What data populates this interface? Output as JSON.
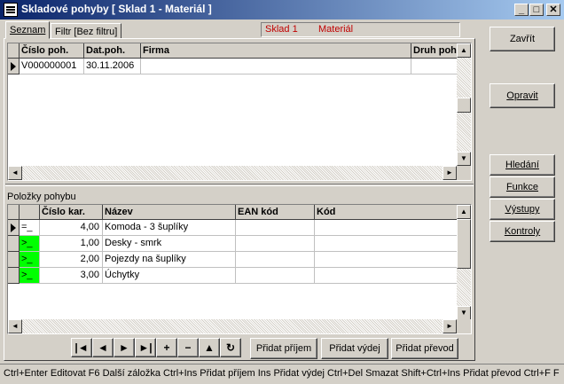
{
  "window": {
    "title": "Skladové pohyby [ Sklad 1 - Materiál ]",
    "minimize": "_",
    "restore": "□",
    "close": "✕"
  },
  "tabs": [
    {
      "label": "Seznam"
    },
    {
      "label": "Filtr [Bez filtru]"
    }
  ],
  "context": {
    "sklad": "Sklad 1",
    "material": "Materiál"
  },
  "top_grid": {
    "columns": [
      "Číslo poh.",
      "Dat.poh.",
      "Firma",
      "Druh pohy"
    ],
    "rows": [
      {
        "cislo": "V000000001",
        "datum": "30.11.2006",
        "firma": "",
        "druh": ""
      }
    ]
  },
  "items_section": {
    "label": "Položky pohybu"
  },
  "items_grid": {
    "columns": [
      "Číslo kar.",
      "Název",
      "EAN kód",
      "Kód"
    ],
    "rows": [
      {
        "status": "=_",
        "cislo": "4,00",
        "nazev": "Komoda - 3 šuplíky",
        "ean": "",
        "kod": ""
      },
      {
        "status": ">_",
        "cislo": "1,00",
        "nazev": "Desky - smrk",
        "ean": "",
        "kod": ""
      },
      {
        "status": ">_",
        "cislo": "2,00",
        "nazev": "Pojezdy na šuplíky",
        "ean": "",
        "kod": ""
      },
      {
        "status": ">_",
        "cislo": "3,00",
        "nazev": "Úchytky",
        "ean": "",
        "kod": ""
      }
    ],
    "status_color": "#00ff00"
  },
  "right_buttons": {
    "zavrit": "Zavřít",
    "opravit": "Opravit",
    "hledani": "Hledání",
    "funkce": "Funkce",
    "vystupy": "Výstupy",
    "kontroly": "Kontroly"
  },
  "navigator": {
    "first": "|◄",
    "prior": "◄",
    "next": "►",
    "last": "►|",
    "insert": "+",
    "delete": "−",
    "edit": "▲",
    "refresh": "↻"
  },
  "actions": {
    "prijem": "Přidat příjem",
    "vydej": "Přidat výdej",
    "prevod": "Přidat převod"
  },
  "status_bar": "Ctrl+Enter Editovat  F6 Další záložka  Ctrl+Ins Přidat příjem  Ins Přidat výdej  Ctrl+Del Smazat  Shift+Ctrl+Ins Přidat převod  Ctrl+F F",
  "colors": {
    "title_start": "#0a246a",
    "title_end": "#a6caf0",
    "context_text": "#c00000"
  }
}
